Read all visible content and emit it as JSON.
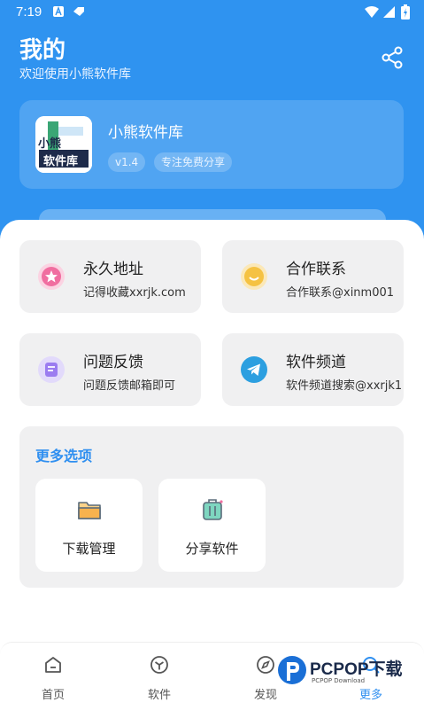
{
  "status_bar": {
    "time": "7:19"
  },
  "header": {
    "title": "我的",
    "subtitle": "欢迎使用小熊软件库",
    "share_icon": "share-icon"
  },
  "app_card": {
    "name": "小熊软件库",
    "version": "v1.4",
    "tag": "专注免费分享",
    "logo_text_top": "小熊",
    "logo_text_bottom": "软件库"
  },
  "tiles": [
    {
      "title": "永久地址",
      "subtitle": "记得收藏xxrjk.com",
      "icon": "star-icon",
      "color": "#f06ea0"
    },
    {
      "title": "合作联系",
      "subtitle": "合作联系@xinm001",
      "icon": "smile-icon",
      "color": "#f5c242"
    },
    {
      "title": "问题反馈",
      "subtitle": "问题反馈邮箱即可",
      "icon": "feedback-icon",
      "color": "#9b7cf0"
    },
    {
      "title": "软件频道",
      "subtitle": "软件频道搜索@xxrjk1",
      "icon": "telegram-icon",
      "color": "#2c9fe0"
    }
  ],
  "more": {
    "title": "更多选项",
    "items": [
      {
        "label": "下载管理",
        "icon": "folder-icon"
      },
      {
        "label": "分享软件",
        "icon": "luggage-icon"
      }
    ]
  },
  "bottom_nav": [
    {
      "label": "首页",
      "icon": "home-icon",
      "active": false
    },
    {
      "label": "软件",
      "icon": "cube-icon",
      "active": false
    },
    {
      "label": "发现",
      "icon": "compass-icon",
      "active": false
    },
    {
      "label": "更多",
      "icon": "search-icon",
      "active": true
    }
  ],
  "watermark": {
    "brand": "PCPOP下载",
    "sub": "PCPOP Download"
  },
  "colors": {
    "primary": "#2f93f0",
    "accent": "#2f8ff0",
    "tile_bg": "#f0f0f1"
  }
}
